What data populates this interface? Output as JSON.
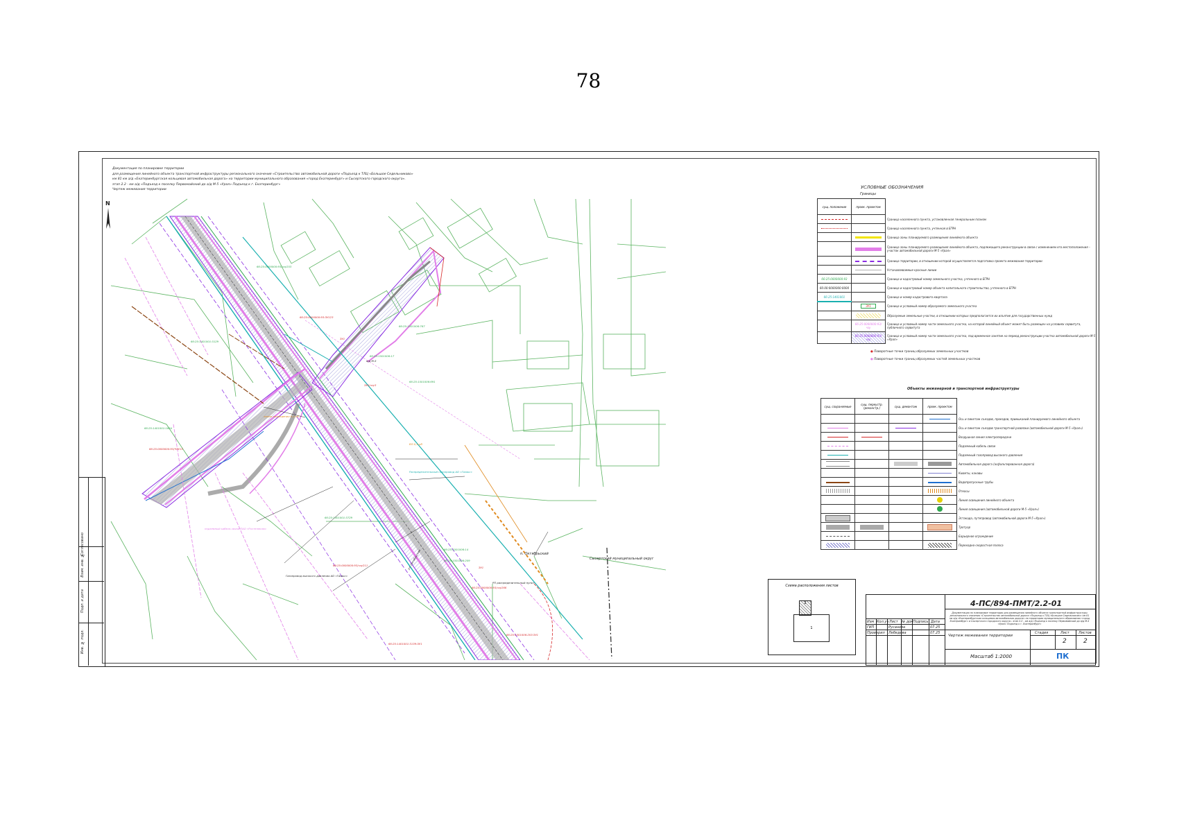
{
  "page_number": "78",
  "header": {
    "line1": "Документация по планировке территории",
    "line2": "для размещения линейного объекта транспортной инфраструктуры регионального значения «Строительство автомобильной дороги «Подъезд к ТЛЦ «Большое Седельниково»",
    "line3": "км 81 км а/д «Екатеринбургская кольцевая автомобильная дорога» на территории муниципального образования «город Екатеринбург» и Сысертского городского округа».",
    "line4": "этап 2.2 - км а/д «Подъезд к поселку Первомайский до а/д М-5 «Урал» Подъезд к г. Екатеринбург»",
    "line5": "Чертеж межевания территории"
  },
  "north_label": "N",
  "map_labels": {
    "place_oktyabrsky": "п. Октябрьский",
    "sysert_district": "Сысертский муниципальный округ",
    "kv1": "66:25:0000000:93/чзу253",
    "kv2": "66:25:0000000:93:ЗУ123",
    "kv3": "66:25:1501006:767",
    "kv4": "66:25:1501006:17",
    "kv5": "66:25:1501006:691",
    "kv6": "66:25:1401001:1684",
    "kv7": "66:25:0000000:93/ЧЗУ13",
    "kv8": "66:25:0000000:93/чзу211",
    "kv9": "66:25:1501006:209",
    "kv10": "66:25:1501006:203:ЗУ1",
    "kv11": "66:25:0000000:93/чзу266",
    "kv12": "66:25:1401001:3729",
    "kv13": "66:25:1501006:14",
    "kv14": "66:25:1401001:3129",
    "kv15": "66:25:1401001:3139:ЗУ1",
    "zu1": "ЗУ1",
    "zu1_chzu3": "ЗУ1/чзу3",
    "zu1_2": "ЗУ1",
    "m5": "а/д М-5",
    "road_label": "ул. Октябрьская",
    "gas": "Газопровод высокого давления АО «Газэкс»",
    "distrib_gas": "Распределительный газопровод АО «Газэкс»",
    "cable": "подземный кабель связи ПАО «Ростелеком»",
    "line_power": "линия подведения 0,4 кВ",
    "vl": "ВЛ-0,4 кВ",
    "rp": "РП распределительный пункт"
  },
  "legend": {
    "title": "УСЛОВНЫЕ ОБОЗНАЧЕНИЯ",
    "subtitle": "Границы",
    "col1": "сущ. положение",
    "col2": "прoeк. проектом",
    "rows": [
      {
        "desc": "Граница населенного пункта, установленная генеральным планом",
        "sym": "line-red-dash"
      },
      {
        "desc": "Граница населенного пункта, учтенная в ЕГРН",
        "sym": "line-red-dot"
      },
      {
        "desc": "Граница зоны планируемого размещения линейного объекта",
        "sym": "line-yellow"
      },
      {
        "desc": "Граница зоны планируемого размещения линейного объекта, подлежащего реконструкции в связи с изменением его местоположения – участок автомобильной дороги М-5 «Урал»",
        "sym": "line-pink"
      },
      {
        "desc": "Граница территории, в отношении которой осуществляется подготовка проекта межевания территории",
        "sym": "line-purple-dash"
      },
      {
        "desc": "Устанавливаемые красные линии",
        "sym": "line-gray"
      },
      {
        "desc": "Граница и кадастровый номер земельного участка, учтенного в ЕГРН",
        "label": "66:25:0000000:93"
      },
      {
        "desc": "Граница и кадастровый номер объекта капитального строительства, учтенного в ЕГРН",
        "label": "66:00:0000000:0000"
      },
      {
        "desc": "Граница и номер кадастрового квартала",
        "label": "66:25:1401001"
      },
      {
        "desc": "Граница и условный номер образуемого земельного участка",
        "label": "ЗУ1"
      },
      {
        "desc": "Образуемые земельные участки, в отношении которых предполагается их изъятие для государственных нужд",
        "sym": "hatch-yellow"
      },
      {
        "desc": "Граница и условный номер части земельного участка, на которой линейный объект может быть размещен на условиях сервитута, публичного сервитута",
        "label": "66:25:0000000:93/чзу"
      },
      {
        "desc": "Граница и условный номер части земельного участка, под временное занятие на период реконструкции участка автомобильной дороги М-5 «Урал»",
        "label": "66:25:0000000:93/чзу"
      }
    ],
    "point1": "Поворотные точки границ образуемых земельных участков",
    "point2": "Поворотные точки границ образуемых частей земельных участков"
  },
  "infra": {
    "title": "Объекты инженерной и транспортной инфраструктуры",
    "col1": "сущ. сохраняемые",
    "col2": "сущ. переустр. (реконстр.)",
    "col3": "сущ. демонтаж",
    "col4": "проек. проектом",
    "rows": [
      "Ось и пикетаж съездов, проездов, примыканий планируемого линейного объекта",
      "Ось и пикетаж съездов транспортной развязки (автомобильной дороги М-5 «Урал»)",
      "Воздушная линия электропередачи",
      "Подземный кабель связи",
      "Подземный газопровод высокого давления",
      "Автомобильная дорога (асфальтированная дорога)",
      "Кюветы, канавы",
      "Водопропускные трубы",
      "Откосы",
      "Линия освещения линейного объекта",
      "Линия освещения (автомобильной дороги М-5 «Урал»)",
      "Эстакада, путепровод (автомобильной дороги М-5 «Урал»)",
      "Тротуар",
      "Барьерное ограждение",
      "Переходно-скоростная полоса"
    ]
  },
  "scheme": {
    "title": "Схема расположения листов",
    "sheet1": "1",
    "sheet2": "2"
  },
  "title_block": {
    "code": "4-ПС/894-ПМТ/2.2-01",
    "description": "Документация по планировке территории для размещения линейного объекта транспортной инфраструктуры регионального значения «Строительство автомобильной дороги «Подъезд к ТЛЦ «Большое Седельниково» км 81 км а/д «Екатеринбургская кольцевая автомобильная дорога» на территории муниципального образования «город Екатеринбург» и Сысертского городского округа». этап 2.2 - км а/д «Подъезд к поселку Первомайский до а/д М-5 «Урал» Подъезд к г. Екатеринбург»",
    "cols": [
      "Изм",
      "Кол.уч",
      "Лист",
      "№ док",
      "Подпись",
      "Дата"
    ],
    "row1": [
      "ГИП",
      "Русанова",
      "07.25"
    ],
    "row2": [
      "Проверил",
      "Лебедева",
      "07.25"
    ],
    "drawing_name": "Чертеж межевания территории",
    "stage_label": "Стадия",
    "sheet_label": "Лист",
    "sheets_label": "Листов",
    "sheet": "2",
    "sheets": "2",
    "scale": "Масштаб 1:2000",
    "logo": "ПК"
  },
  "stamp": {
    "s1": "Согласовано",
    "s2": "Взам. инв. №",
    "s3": "Подп. и дата",
    "s4": "Инв. № подл."
  },
  "colors": {
    "pink": "#e27ee8",
    "purple": "#8a2be2",
    "teal": "#1ab0b0",
    "green": "#2fa84f",
    "red": "#d62728",
    "orange": "#e08a1e",
    "gray_road": "#9e9e9e"
  }
}
